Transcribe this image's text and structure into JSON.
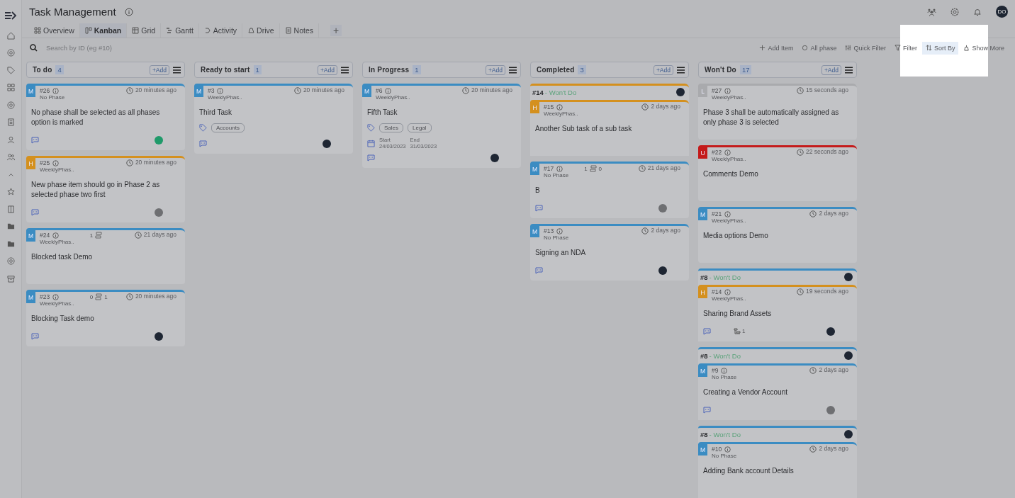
{
  "app": {
    "title": "Task Management",
    "user_initials": "DO"
  },
  "tabs": [
    {
      "label": "Overview",
      "selected": false
    },
    {
      "label": "Kanban",
      "selected": true
    },
    {
      "label": "Grid",
      "selected": false
    },
    {
      "label": "Gantt",
      "selected": false
    },
    {
      "label": "Activity",
      "selected": false
    },
    {
      "label": "Drive",
      "selected": false
    },
    {
      "label": "Notes",
      "selected": false
    }
  ],
  "add_tab": "+",
  "search": {
    "placeholder": "Search by ID (eg #10)"
  },
  "toolbar": [
    {
      "label": "Add Item",
      "hovered": false
    },
    {
      "label": "All phase",
      "hovered": false
    },
    {
      "label": "Quick Filter",
      "hovered": false
    },
    {
      "label": "Filter",
      "hovered": false
    },
    {
      "label": "Sort By",
      "hovered": true
    },
    {
      "label": "Show More",
      "hovered": false
    }
  ],
  "columns": [
    {
      "title": "To do",
      "count": "4",
      "add": "+Add",
      "cards": [
        {
          "kind": "task",
          "priority": {
            "letter": "M",
            "color": "#3b8cc2"
          },
          "id": "#26",
          "phase": "No Phase",
          "time": "20 minutes ago",
          "title": "No phase shall be selected as all phases option is marked",
          "comments": true,
          "avatar": {
            "color": "#1f9a6a"
          }
        },
        {
          "kind": "task",
          "priority": {
            "letter": "H",
            "color": "#d4901e"
          },
          "id": "#25",
          "phase": "WeeklyPhas..",
          "time": "20 minutes ago",
          "title": "New phase item should go in Phase 2 as selected phase two first",
          "comments": true,
          "avatar": {
            "color": "#6e6f72"
          }
        },
        {
          "kind": "task",
          "priority": {
            "letter": "M",
            "color": "#3b8cc2"
          },
          "id": "#24",
          "phase": "WeeklyPhas..",
          "links": {
            "before": "1"
          },
          "time": "21 days ago",
          "title": "Blocked task Demo"
        },
        {
          "kind": "task",
          "priority": {
            "letter": "M",
            "color": "#3b8cc2"
          },
          "id": "#23",
          "phase": "WeeklyPhas..",
          "links": {
            "before": "0",
            "after": "1"
          },
          "time": "20 minutes ago",
          "title": "Blocking Task demo",
          "comments": true,
          "avatar": {
            "color": "#1e2633"
          }
        }
      ]
    },
    {
      "title": "Ready to start",
      "count": "1",
      "add": "+Add",
      "cards": [
        {
          "kind": "task",
          "priority": {
            "letter": "M",
            "color": "#3b8cc2"
          },
          "id": "#3",
          "phase": "WeeklyPhas..",
          "time": "20 minutes ago",
          "title": "Third Task",
          "tags": [
            "Accounts"
          ],
          "comments": true,
          "avatar": {
            "color": "#1e2633"
          }
        }
      ]
    },
    {
      "title": "In Progress",
      "count": "1",
      "add": "+Add",
      "cards": [
        {
          "kind": "task",
          "priority": {
            "letter": "M",
            "color": "#3b8cc2"
          },
          "id": "#6",
          "phase": "WeeklyPhas..",
          "time": "20 minutes ago",
          "title": "Fifth Task",
          "tags": [
            "Sales",
            "Legal"
          ],
          "dates": {
            "start_label": "Start",
            "start": "24/03/2023",
            "end_label": "End",
            "end": "31/03/2023"
          },
          "comments": true,
          "avatar": {
            "color": "#1e2633"
          }
        }
      ]
    },
    {
      "title": "Completed",
      "count": "3",
      "add": "+Add",
      "cards": [
        {
          "kind": "group",
          "id": "#14",
          "status": "- Won't Do",
          "color": "#d4901e",
          "avatar": {
            "color": "#1e2633"
          },
          "child": {
            "priority": {
              "letter": "H",
              "color": "#d4901e"
            },
            "id": "#15",
            "phase": "WeeklyPhas..",
            "time": "2 days ago",
            "title": "Another Sub task of a sub task"
          }
        },
        {
          "kind": "task",
          "priority": {
            "letter": "M",
            "color": "#3b8cc2"
          },
          "id": "#17",
          "phase": "No Phase",
          "links": {
            "before": "1",
            "after": "0"
          },
          "time": "21 days ago",
          "title": "B",
          "comments": true,
          "avatar": {
            "color": "#6e6f72"
          }
        },
        {
          "kind": "task",
          "priority": {
            "letter": "M",
            "color": "#3b8cc2"
          },
          "id": "#13",
          "phase": "No Phase",
          "time": "2 days ago",
          "title": "Signing an NDA",
          "comments": true,
          "avatar": {
            "color": "#1e2633"
          }
        }
      ]
    },
    {
      "title": "Won't Do",
      "count": "17",
      "add": "+Add",
      "cards": [
        {
          "kind": "task",
          "priority": {
            "letter": "L",
            "color": "#a9aaad"
          },
          "id": "#27",
          "phase": "WeeklyPhas..",
          "time": "15 seconds ago",
          "title": "Phase 3 shall be automatically assigned as only phase 3 is selected"
        },
        {
          "kind": "task",
          "priority": {
            "letter": "U",
            "color": "#c41a1a"
          },
          "id": "#22",
          "phase": "WeeklyPhas..",
          "time": "22 seconds ago",
          "title": "Comments Demo"
        },
        {
          "kind": "task",
          "priority": {
            "letter": "M",
            "color": "#3b8cc2"
          },
          "id": "#21",
          "phase": "WeeklyPhas..",
          "time": "2 days ago",
          "title": "Media options Demo"
        },
        {
          "kind": "group",
          "id": "#8",
          "status": "- Won't Do",
          "color": "#3b8cc2",
          "avatar": {
            "color": "#1e2633"
          },
          "child": {
            "priority": {
              "letter": "H",
              "color": "#d4901e"
            },
            "id": "#14",
            "phase": "WeeklyPhas..",
            "time": "19 seconds ago",
            "title": "Sharing Brand Assets",
            "comments": true,
            "subtasks": "1",
            "avatar": {
              "color": "#1e2633"
            }
          }
        },
        {
          "kind": "group",
          "id": "#8",
          "status": "- Won't Do",
          "color": "#3b8cc2",
          "avatar": {
            "color": "#1e2633"
          },
          "child": {
            "priority": {
              "letter": "M",
              "color": "#3b8cc2"
            },
            "id": "#9",
            "phase": "No Phase",
            "time": "2 days ago",
            "title": "Creating a Vendor Account",
            "comments": true,
            "avatar": {
              "color": "#6e6f72"
            }
          }
        },
        {
          "kind": "group",
          "id": "#8",
          "status": "- Won't Do",
          "color": "#3b8cc2",
          "avatar": {
            "color": "#1e2633"
          },
          "child": {
            "priority": {
              "letter": "M",
              "color": "#3b8cc2"
            },
            "id": "#10",
            "phase": "No Phase",
            "time": "2 days ago",
            "title": "Adding Bank account Details"
          }
        }
      ]
    }
  ]
}
